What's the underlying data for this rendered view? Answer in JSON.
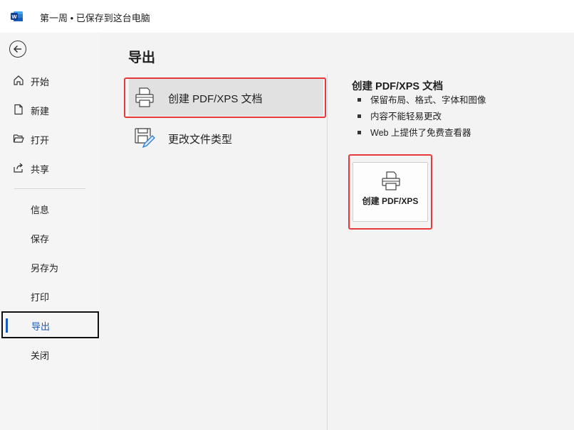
{
  "titlebar": {
    "app_icon": "word-logo",
    "document_title": "第一周 • 已保存到这台电脑"
  },
  "sidebar": {
    "back_icon": "back-arrow-icon",
    "items": [
      {
        "label": "开始",
        "icon": "home-icon"
      },
      {
        "label": "新建",
        "icon": "new-document-icon"
      },
      {
        "label": "打开",
        "icon": "folder-open-icon"
      },
      {
        "label": "共享",
        "icon": "share-icon"
      },
      {
        "label": "信息"
      },
      {
        "label": "保存"
      },
      {
        "label": "另存为"
      },
      {
        "label": "打印"
      },
      {
        "label": "导出",
        "active": true
      },
      {
        "label": "关闭"
      }
    ]
  },
  "main": {
    "title": "导出",
    "options": [
      {
        "label": "创建 PDF/XPS 文档",
        "icon": "pdf-printer-icon",
        "selected": true
      },
      {
        "label": "更改文件类型",
        "icon": "change-filetype-icon",
        "selected": false
      }
    ],
    "detail": {
      "title": "创建 PDF/XPS 文档",
      "bullets": [
        "保留布局、格式、字体和图像",
        "内容不能轻易更改",
        "Web 上提供了免费查看器"
      ],
      "button_label": "创建 PDF/XPS",
      "button_icon": "pdf-printer-icon"
    }
  },
  "colors": {
    "accent": "#185abd",
    "highlight": "#e8393a",
    "word_blue": "#2b579a"
  }
}
